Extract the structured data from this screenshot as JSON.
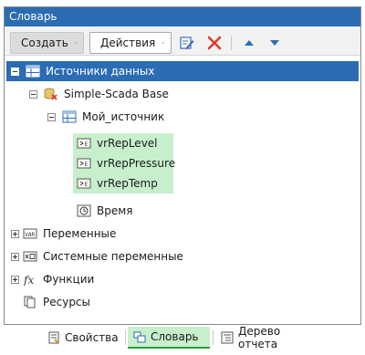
{
  "panel": {
    "title": "Словарь"
  },
  "toolbar": {
    "create_label": "Создать",
    "actions_label": "Действия",
    "icons": [
      "edit-icon",
      "delete-icon",
      "move-up-icon",
      "move-down-icon"
    ]
  },
  "tree": {
    "data_sources": "Источники данных",
    "simple_scada": "Simple-Scada Base",
    "my_source": "Мой_источник",
    "var_level": "vrRepLevel",
    "var_pressure": "vrRepPressure",
    "var_temp": "vrRepTemp",
    "time": "Время",
    "variables": "Переменные",
    "system_variables": "Системные переменные",
    "functions": "Функции",
    "resources": "Ресурсы"
  },
  "tabs": {
    "properties": "Свойства",
    "dictionary": "Словарь",
    "report_tree": "Дерево отчета"
  },
  "colors": {
    "accent": "#2b6cb3",
    "highlight": "#c8efcc",
    "active_tab_line": "#2b9e45",
    "delete": "#e03a2f"
  }
}
